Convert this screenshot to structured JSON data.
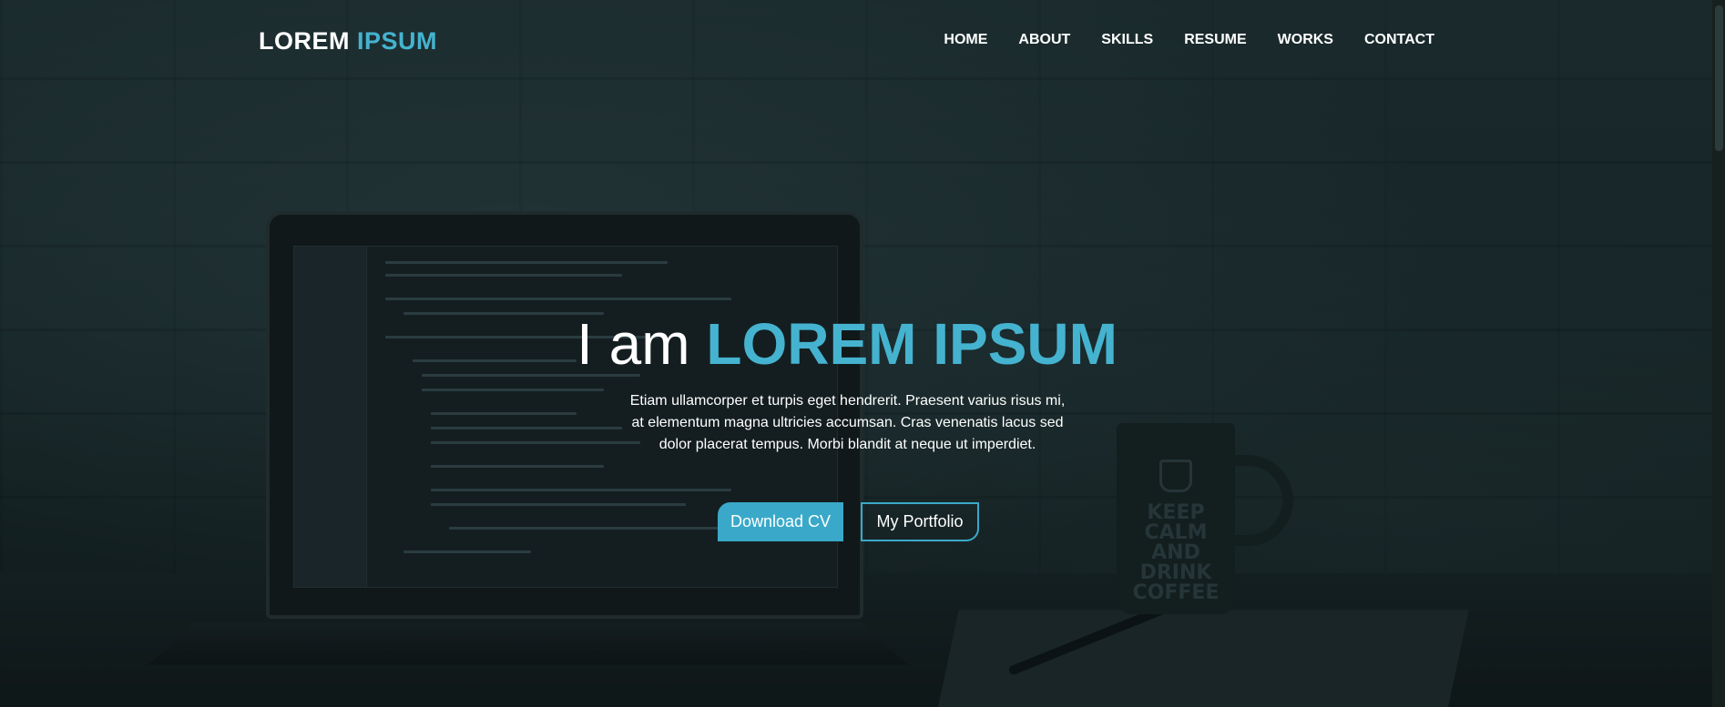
{
  "brand": {
    "logo_part1": "LOREM ",
    "logo_part2": "IPSUM",
    "accent_color": "#45b3cf"
  },
  "nav": {
    "items": [
      {
        "label": "HOME"
      },
      {
        "label": "ABOUT"
      },
      {
        "label": "SKILLS"
      },
      {
        "label": "RESUME"
      },
      {
        "label": "WORKS"
      },
      {
        "label": "CONTACT"
      }
    ]
  },
  "hero": {
    "headline_prefix": "I am ",
    "headline_name": "LOREM IPSUM",
    "description": "Etiam ullamcorper et turpis eget hendrerit. Praesent varius risus mi, at elementum magna ultricies accumsan. Cras venenatis lacus sed dolor placerat tempus. Morbi blandit at neque ut imperdiet.",
    "primary_button": "Download CV",
    "secondary_button": "My Portfolio"
  },
  "background": {
    "mug_text": "KEEP CALM AND DRINK COFFEE",
    "icon": "laptop-desk-photo"
  }
}
